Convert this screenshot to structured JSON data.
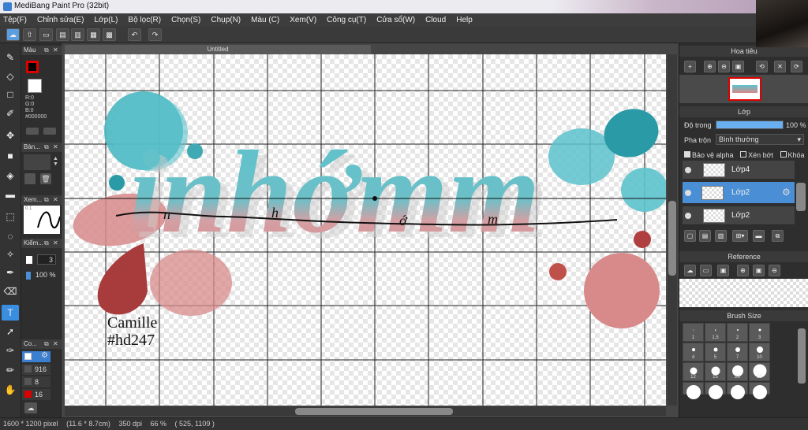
{
  "window": {
    "title": "MediBang Paint Pro (32bit)"
  },
  "menu": [
    "Tệp(F)",
    "Chỉnh sửa(E)",
    "Lớp(L)",
    "Bộ lọc(R)",
    "Chọn(S)",
    "Chụp(N)",
    "Màu (C)",
    "Xem(V)",
    "Công cụ(T)",
    "Cửa sổ(W)",
    "Cloud",
    "Help"
  ],
  "document": {
    "tab_title": "Untitled",
    "signature_name": "Camille",
    "signature_tag": "#hd247"
  },
  "left_panels": {
    "color_title": "Màu",
    "rgb_r": "R:0",
    "rgb_g": "G:0",
    "rgb_b": "B:0",
    "hex": "#000000",
    "brush_title": "Bàn...",
    "stroke_title": "Xem...",
    "check_title": "Kiểm...",
    "stroke_label": "0.1",
    "size_value": "3",
    "opacity_value": "100 %",
    "co_title": "Co...",
    "co_rows": [
      "916",
      "8",
      "16"
    ]
  },
  "navigator": {
    "title": "Hoa tiêu"
  },
  "layers": {
    "title": "Lớp",
    "opacity_label": "Độ trong",
    "opacity_value": "100 %",
    "opacity_fraction": 1.0,
    "blend_label": "Pha trộn",
    "blend_value": "Bình thường",
    "protect_alpha": "Bảo vệ alpha",
    "clip": "Xén bớt",
    "lock": "Khóa",
    "items": [
      {
        "name": "Lớp4",
        "selected": false
      },
      {
        "name": "Lớp2",
        "selected": true
      },
      {
        "name": "Lớp2",
        "selected": false
      }
    ]
  },
  "reference": {
    "title": "Reference"
  },
  "brush_size": {
    "title": "Brush Size",
    "sizes": [
      "1",
      "1.5",
      "2",
      "3",
      "4",
      "5",
      "7",
      "10",
      "12",
      "15",
      "20",
      "25"
    ]
  },
  "status": {
    "size": "1600 * 1200 pixel",
    "cm": "(11.6 * 8.7cm)",
    "dpi": "350 dpi",
    "zoom": "66 %",
    "coords": "( 525, 1109 )"
  },
  "colors": {
    "accent": "#4a8fd6",
    "teal": "#5cc2cc",
    "rose": "#d88a8a",
    "dark_red": "#a83b3b",
    "dark_teal": "#2a9aa6"
  }
}
